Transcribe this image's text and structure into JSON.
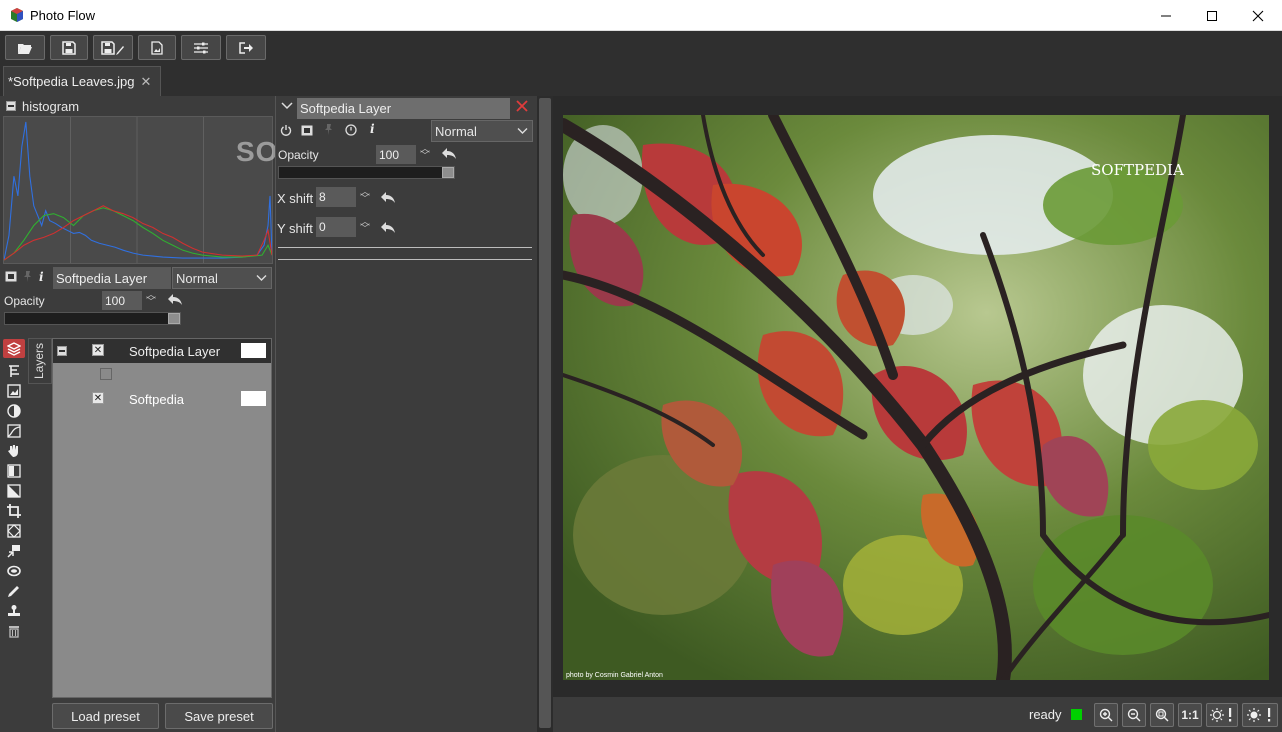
{
  "window": {
    "title": "Photo Flow",
    "minimize_label": "—",
    "maximize_label": "☐",
    "close_label": "✕"
  },
  "toolbar": {
    "buttons": [
      "open",
      "save",
      "save-as",
      "export",
      "settings",
      "exit"
    ]
  },
  "tab": {
    "label": "*Softpedia Leaves.jpg",
    "close_label": "✕"
  },
  "histogram": {
    "title": "histogram"
  },
  "left_layer_props": {
    "layer_name": "Softpedia Layer",
    "blend_mode": "Normal",
    "opacity_label": "Opacity",
    "opacity_value": "100",
    "opacity_fraction": 1.0
  },
  "layers": {
    "tab_label": "Layers",
    "rows": [
      {
        "name": "Softpedia Layer",
        "checked": true,
        "selected": true
      },
      {
        "name": "",
        "checked": false,
        "selected": false
      },
      {
        "name": "Softpedia",
        "checked": true,
        "selected": false
      }
    ],
    "load_preset_label": "Load preset",
    "save_preset_label": "Save preset"
  },
  "mid_panel": {
    "title": "Softpedia Layer",
    "close_label": "✕",
    "blend_mode": "Normal",
    "opacity_label": "Opacity",
    "opacity_value": "100",
    "opacity_fraction": 1.0,
    "xshift_label": "X shift",
    "xshift_value": "8",
    "yshift_label": "Y shift",
    "yshift_value": "0"
  },
  "watermarks": {
    "softpedia_overlay": "SOFTPEDIA",
    "photo_brand": "SOFTPEDIA",
    "photo_credit": "photo by Cosmin Gabriel Anton"
  },
  "status": {
    "text": "ready",
    "indicator_color": "#00d000",
    "zoom_fit_label": "1:1"
  },
  "colors": {
    "panel_bg": "#3c3c3c",
    "toolbar_bg": "#2f2f2f",
    "selected_row": "#303030",
    "histogram_red": "#d03030",
    "histogram_green": "#30b030",
    "histogram_blue": "#3070e0"
  }
}
